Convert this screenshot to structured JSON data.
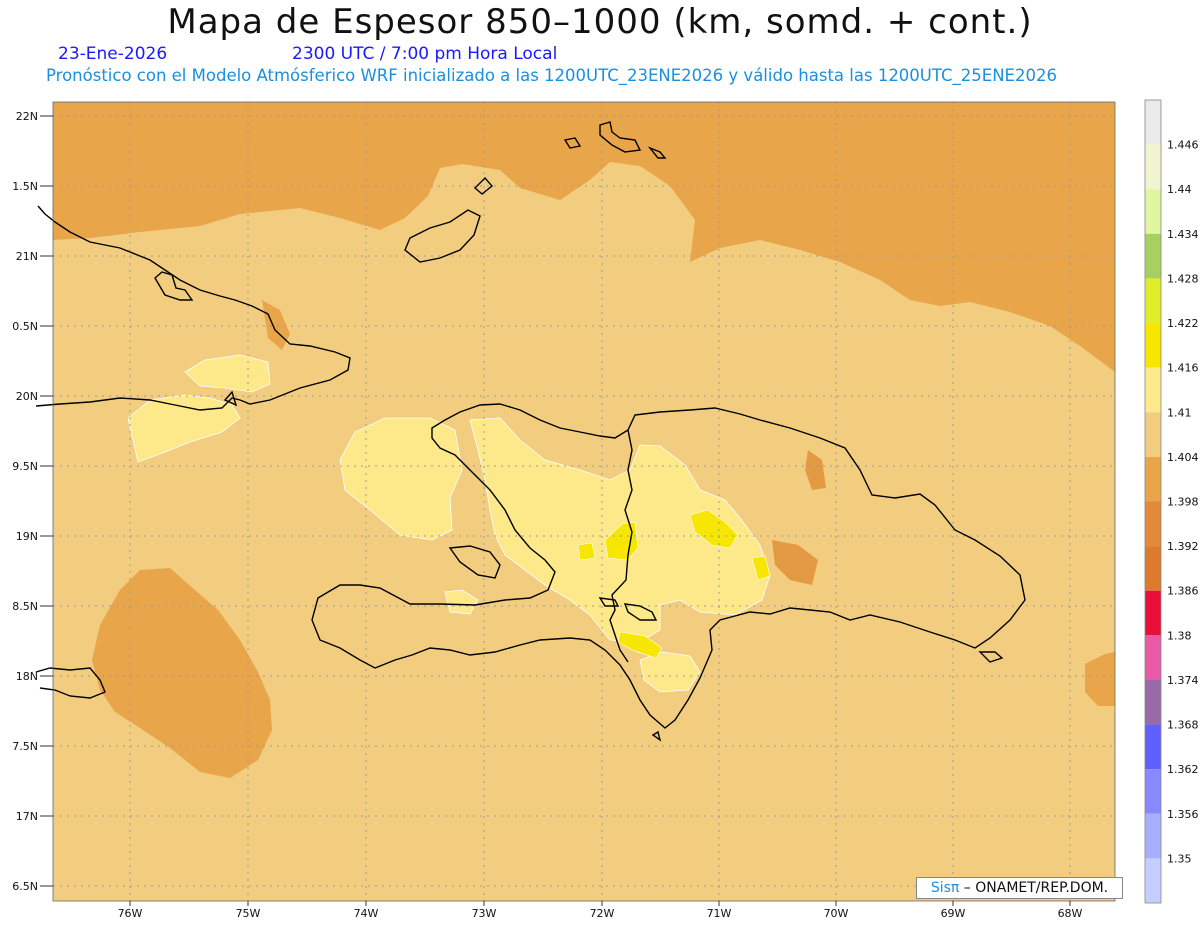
{
  "header": {
    "title": "Mapa de Espesor 850–1000 (km, somd. + cont.)",
    "date": "23-Ene-2026",
    "time": "2300 UTC / 7:00 pm Hora Local",
    "model_info": "Pronóstico con el Modelo Atmósferico WRF inicializado a las 1200UTC_23ENE2026 y válido hasta las  1200UTC_25ENE2026"
  },
  "map": {
    "lat_labels": [
      "22N",
      "1.5N",
      "21N",
      "0.5N",
      "20N",
      "9.5N",
      "19N",
      "8.5N",
      "18N",
      "7.5N",
      "17N",
      "6.5N"
    ],
    "lon_labels": [
      "76W",
      "75W",
      "74W",
      "73W",
      "72W",
      "71W",
      "70W",
      "69W",
      "68W"
    ],
    "colors": {
      "ocean_deep": "#e9a54a",
      "ocean_darker": "#e39a42",
      "land_base": "#f2cd80",
      "warm_zone": "#fde88a",
      "peak": "#f7e600",
      "coast": "#000000",
      "grid": "#9a9a9a"
    }
  },
  "colorbar": {
    "labels": [
      "1.446",
      "1.44",
      "1.434",
      "1.428",
      "1.422",
      "1.416",
      "1.41",
      "1.404",
      "1.398",
      "1.392",
      "1.386",
      "1.38",
      "1.374",
      "1.368",
      "1.362",
      "1.356",
      "1.35"
    ],
    "colors": [
      "#eaeaea",
      "#f0f5d0",
      "#dff5a0",
      "#a8d060",
      "#e0ee2a",
      "#f7e600",
      "#fde88a",
      "#f2cd80",
      "#e9a54a",
      "#e38a3a",
      "#dc7a2e",
      "#e8103a",
      "#e85aa8",
      "#9a6aa8",
      "#6060ff",
      "#8888ff",
      "#a6b0ff",
      "#c4ceff"
    ]
  },
  "credit": {
    "sis": "Sisπ",
    "org": " –  ONAMET/REP.DOM."
  }
}
